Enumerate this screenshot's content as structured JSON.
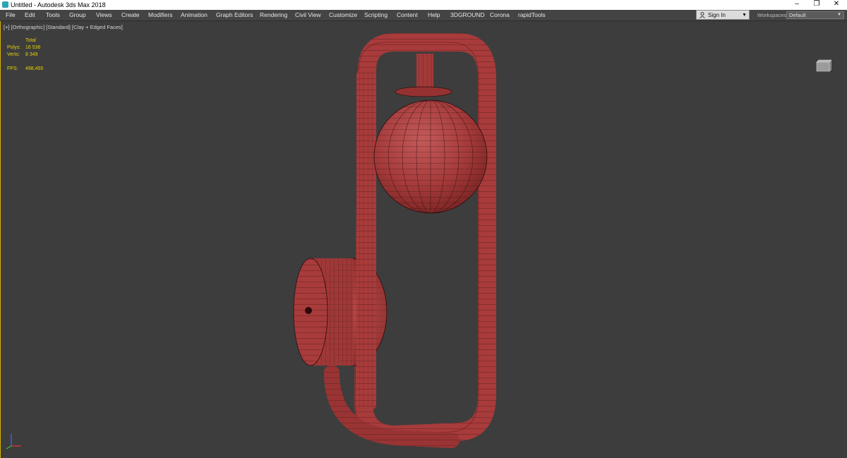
{
  "window": {
    "title": "Untitled - Autodesk 3ds Max 2018",
    "controls": [
      "–",
      "❐",
      "✕"
    ]
  },
  "menu": [
    "File",
    "Edit",
    "Tools",
    "Group",
    "Views",
    "Create",
    "Modifiers",
    "Animation",
    "Graph Editors",
    "Rendering",
    "Civil View",
    "Customize",
    "Scripting",
    "Content",
    "Help",
    "3DGROUND",
    "Corona",
    "rapidTools"
  ],
  "signin": {
    "label": "Sign In"
  },
  "workspaces": {
    "label": "Workspaces:",
    "value": "Default"
  },
  "viewport": {
    "labels": "[+] [Orthographic] [Standard] [Clay + Edged Faces]",
    "stats": {
      "total_label": "Total",
      "polys_label": "Polys:",
      "polys_value": "16 536",
      "verts_label": "Verts:",
      "verts_value": "8 349",
      "fps_label": "FPS:",
      "fps_value": "498,455"
    }
  },
  "colors": {
    "background": "#3d3d3d",
    "model": "#a83b3b",
    "wire": "#2a0c0c",
    "stats_text": "#e8d200",
    "viewport_border": "#d9b400"
  }
}
